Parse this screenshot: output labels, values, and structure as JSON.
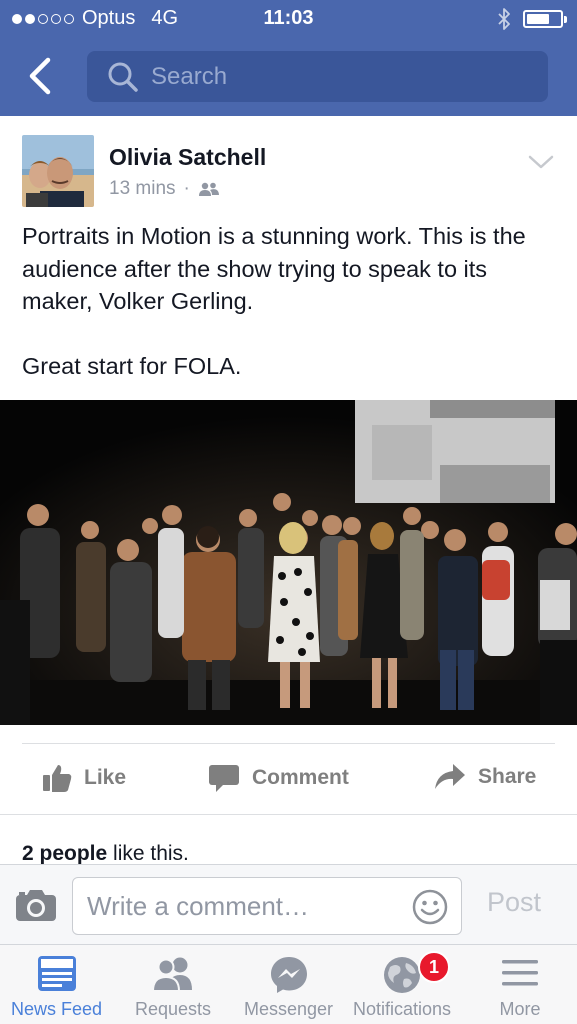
{
  "status_bar": {
    "carrier": "Optus",
    "network": "4G",
    "time": "11:03",
    "signal_bars": 2,
    "battery_level": 0.7
  },
  "nav": {
    "search_placeholder": "Search"
  },
  "post": {
    "author": "Olivia Satchell",
    "time_ago": "13 mins",
    "audience_icon": "friends-icon",
    "text_lines": [
      "Portraits in Motion is a stunning work. This is the audience after the show trying to speak to its maker, Volker Gerling.",
      "Great start for FOLA."
    ],
    "actions": {
      "like": "Like",
      "comment": "Comment",
      "share": "Share"
    },
    "likes_summary": {
      "count_text": "2 people",
      "suffix": " like this."
    }
  },
  "comment_bar": {
    "placeholder": "Write a comment…",
    "post_label": "Post"
  },
  "tabs": [
    {
      "label": "News Feed",
      "icon": "news-feed-icon",
      "active": true
    },
    {
      "label": "Requests",
      "icon": "friend-requests-icon",
      "active": false
    },
    {
      "label": "Messenger",
      "icon": "messenger-icon",
      "active": false
    },
    {
      "label": "Notifications",
      "icon": "globe-icon",
      "active": false,
      "badge": "1"
    },
    {
      "label": "More",
      "icon": "hamburger-menu-icon",
      "active": false
    }
  ],
  "colors": {
    "brand_blue": "#4a67ad",
    "active_tab": "#4a80d9",
    "badge_red": "#e8192c"
  }
}
